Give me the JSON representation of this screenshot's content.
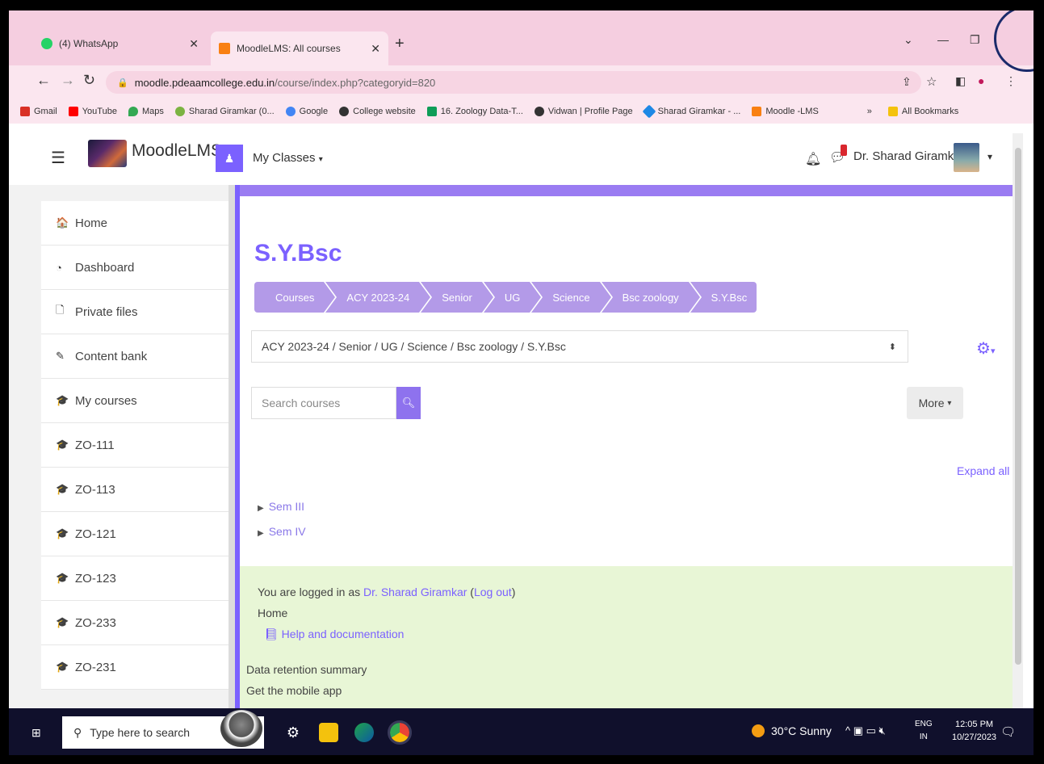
{
  "browser": {
    "tabs": [
      {
        "label": "(4) WhatsApp",
        "active": false
      },
      {
        "label": "MoodleLMS: All courses",
        "active": true
      }
    ],
    "new_tab_label": "+",
    "url_host": "moodle.pdeaamcollege.edu.in",
    "url_path": "/course/index.php?categoryid=820",
    "bookmarks": [
      {
        "label": "Gmail",
        "color": "#d93025"
      },
      {
        "label": "YouTube",
        "color": "#ff0000"
      },
      {
        "label": "Maps",
        "color": "#34a853"
      },
      {
        "label": "Sharad Giramkar (0...",
        "color": "#7cb342"
      },
      {
        "label": "Google",
        "color": "#4285f4"
      },
      {
        "label": "College website",
        "color": "#333333"
      },
      {
        "label": "16. Zoology Data-T...",
        "color": "#0f9d58"
      },
      {
        "label": "Vidwan | Profile Page",
        "color": "#333333"
      },
      {
        "label": "Sharad Giramkar - ...",
        "color": "#1e88e5"
      },
      {
        "label": "Moodle -LMS",
        "color": "#f98012"
      }
    ],
    "bookmarks_overflow": "»",
    "all_bookmarks": "All Bookmarks"
  },
  "navbar": {
    "brand": "MoodleLMS",
    "my_classes": "My Classes",
    "user_name": "Dr. Sharad Giramkar"
  },
  "sidebar": {
    "items": [
      {
        "label": "Home",
        "icon": "home-icon",
        "glyph": "🏠"
      },
      {
        "label": "Dashboard",
        "icon": "dashboard-icon",
        "glyph": "◔"
      },
      {
        "label": "Private files",
        "icon": "file-icon",
        "glyph": "🗋"
      },
      {
        "label": "Content bank",
        "icon": "brush-icon",
        "glyph": "✎"
      },
      {
        "label": "My courses",
        "icon": "graduation-cap-icon",
        "glyph": "🎓"
      },
      {
        "label": "ZO-111",
        "icon": "graduation-cap-icon",
        "glyph": "🎓"
      },
      {
        "label": "ZO-113",
        "icon": "graduation-cap-icon",
        "glyph": "🎓"
      },
      {
        "label": "ZO-121",
        "icon": "graduation-cap-icon",
        "glyph": "🎓"
      },
      {
        "label": "ZO-123",
        "icon": "graduation-cap-icon",
        "glyph": "🎓"
      },
      {
        "label": "ZO-233",
        "icon": "graduation-cap-icon",
        "glyph": "🎓"
      },
      {
        "label": "ZO-231",
        "icon": "graduation-cap-icon",
        "glyph": "🎓"
      }
    ]
  },
  "main": {
    "title": "S.Y.Bsc",
    "breadcrumb": [
      "Courses",
      "ACY 2023-24",
      "Senior",
      "UG",
      "Science",
      "Bsc zoology",
      "S.Y.Bsc"
    ],
    "category_select": "ACY 2023-24 / Senior / UG / Science / Bsc zoology / S.Y.Bsc",
    "search_placeholder": "Search courses",
    "more_label": "More",
    "expand_all": "Expand all",
    "sections": [
      "Sem III",
      "Sem IV"
    ],
    "accent_color": "#7b61ff"
  },
  "footer": {
    "logged_in_prefix": "You are logged in as",
    "user_link": "Dr. Sharad Giramkar",
    "logout": "Log out",
    "home": "Home",
    "help": "Help and documentation",
    "data_retention": "Data retention summary",
    "mobile_app": "Get the mobile app"
  },
  "taskbar": {
    "search_placeholder": "Type here to search",
    "weather": "30°C  Sunny",
    "lang_1": "ENG",
    "lang_2": "IN",
    "time": "12:05 PM",
    "date": "10/27/2023"
  }
}
